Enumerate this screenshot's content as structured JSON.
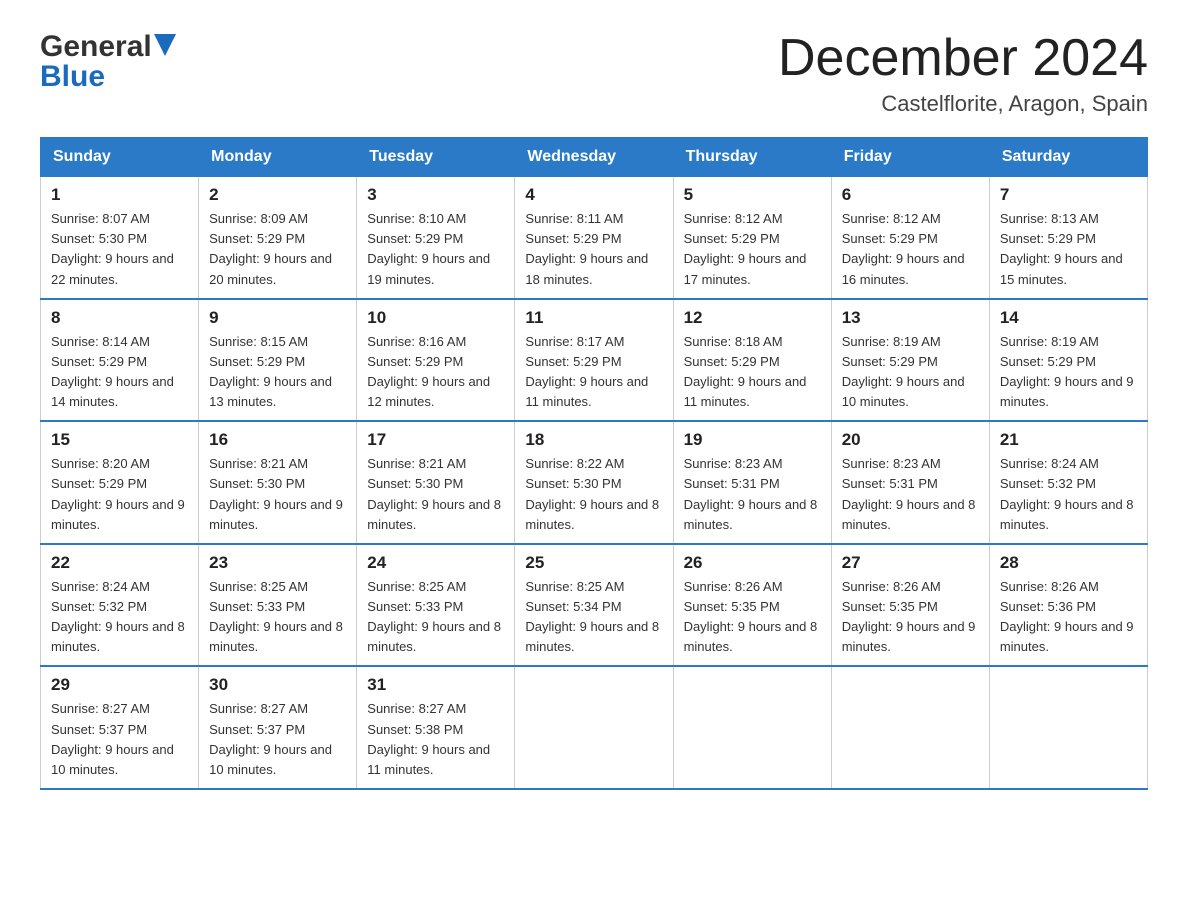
{
  "header": {
    "logo_general": "General",
    "logo_blue": "Blue",
    "month_title": "December 2024",
    "location": "Castelflorite, Aragon, Spain"
  },
  "days_of_week": [
    "Sunday",
    "Monday",
    "Tuesday",
    "Wednesday",
    "Thursday",
    "Friday",
    "Saturday"
  ],
  "weeks": [
    [
      {
        "num": "1",
        "sunrise": "8:07 AM",
        "sunset": "5:30 PM",
        "daylight": "9 hours and 22 minutes."
      },
      {
        "num": "2",
        "sunrise": "8:09 AM",
        "sunset": "5:29 PM",
        "daylight": "9 hours and 20 minutes."
      },
      {
        "num": "3",
        "sunrise": "8:10 AM",
        "sunset": "5:29 PM",
        "daylight": "9 hours and 19 minutes."
      },
      {
        "num": "4",
        "sunrise": "8:11 AM",
        "sunset": "5:29 PM",
        "daylight": "9 hours and 18 minutes."
      },
      {
        "num": "5",
        "sunrise": "8:12 AM",
        "sunset": "5:29 PM",
        "daylight": "9 hours and 17 minutes."
      },
      {
        "num": "6",
        "sunrise": "8:12 AM",
        "sunset": "5:29 PM",
        "daylight": "9 hours and 16 minutes."
      },
      {
        "num": "7",
        "sunrise": "8:13 AM",
        "sunset": "5:29 PM",
        "daylight": "9 hours and 15 minutes."
      }
    ],
    [
      {
        "num": "8",
        "sunrise": "8:14 AM",
        "sunset": "5:29 PM",
        "daylight": "9 hours and 14 minutes."
      },
      {
        "num": "9",
        "sunrise": "8:15 AM",
        "sunset": "5:29 PM",
        "daylight": "9 hours and 13 minutes."
      },
      {
        "num": "10",
        "sunrise": "8:16 AM",
        "sunset": "5:29 PM",
        "daylight": "9 hours and 12 minutes."
      },
      {
        "num": "11",
        "sunrise": "8:17 AM",
        "sunset": "5:29 PM",
        "daylight": "9 hours and 11 minutes."
      },
      {
        "num": "12",
        "sunrise": "8:18 AM",
        "sunset": "5:29 PM",
        "daylight": "9 hours and 11 minutes."
      },
      {
        "num": "13",
        "sunrise": "8:19 AM",
        "sunset": "5:29 PM",
        "daylight": "9 hours and 10 minutes."
      },
      {
        "num": "14",
        "sunrise": "8:19 AM",
        "sunset": "5:29 PM",
        "daylight": "9 hours and 9 minutes."
      }
    ],
    [
      {
        "num": "15",
        "sunrise": "8:20 AM",
        "sunset": "5:29 PM",
        "daylight": "9 hours and 9 minutes."
      },
      {
        "num": "16",
        "sunrise": "8:21 AM",
        "sunset": "5:30 PM",
        "daylight": "9 hours and 9 minutes."
      },
      {
        "num": "17",
        "sunrise": "8:21 AM",
        "sunset": "5:30 PM",
        "daylight": "9 hours and 8 minutes."
      },
      {
        "num": "18",
        "sunrise": "8:22 AM",
        "sunset": "5:30 PM",
        "daylight": "9 hours and 8 minutes."
      },
      {
        "num": "19",
        "sunrise": "8:23 AM",
        "sunset": "5:31 PM",
        "daylight": "9 hours and 8 minutes."
      },
      {
        "num": "20",
        "sunrise": "8:23 AM",
        "sunset": "5:31 PM",
        "daylight": "9 hours and 8 minutes."
      },
      {
        "num": "21",
        "sunrise": "8:24 AM",
        "sunset": "5:32 PM",
        "daylight": "9 hours and 8 minutes."
      }
    ],
    [
      {
        "num": "22",
        "sunrise": "8:24 AM",
        "sunset": "5:32 PM",
        "daylight": "9 hours and 8 minutes."
      },
      {
        "num": "23",
        "sunrise": "8:25 AM",
        "sunset": "5:33 PM",
        "daylight": "9 hours and 8 minutes."
      },
      {
        "num": "24",
        "sunrise": "8:25 AM",
        "sunset": "5:33 PM",
        "daylight": "9 hours and 8 minutes."
      },
      {
        "num": "25",
        "sunrise": "8:25 AM",
        "sunset": "5:34 PM",
        "daylight": "9 hours and 8 minutes."
      },
      {
        "num": "26",
        "sunrise": "8:26 AM",
        "sunset": "5:35 PM",
        "daylight": "9 hours and 8 minutes."
      },
      {
        "num": "27",
        "sunrise": "8:26 AM",
        "sunset": "5:35 PM",
        "daylight": "9 hours and 9 minutes."
      },
      {
        "num": "28",
        "sunrise": "8:26 AM",
        "sunset": "5:36 PM",
        "daylight": "9 hours and 9 minutes."
      }
    ],
    [
      {
        "num": "29",
        "sunrise": "8:27 AM",
        "sunset": "5:37 PM",
        "daylight": "9 hours and 10 minutes."
      },
      {
        "num": "30",
        "sunrise": "8:27 AM",
        "sunset": "5:37 PM",
        "daylight": "9 hours and 10 minutes."
      },
      {
        "num": "31",
        "sunrise": "8:27 AM",
        "sunset": "5:38 PM",
        "daylight": "9 hours and 11 minutes."
      },
      null,
      null,
      null,
      null
    ]
  ]
}
